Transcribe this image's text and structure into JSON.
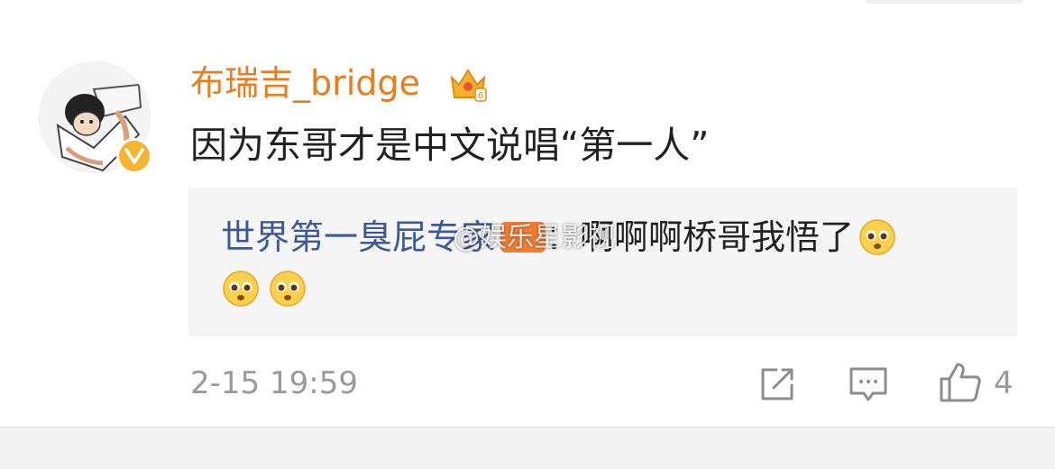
{
  "comment": {
    "username": "布瑞吉_bridge",
    "text": "因为东哥才是中文说唱“第一人”",
    "timestamp": "2-15 19:59",
    "like_count": "4"
  },
  "reply": {
    "username": "世界第一臭屁专家",
    "separator": "：",
    "text": "啊啊啊桥哥我悟了"
  },
  "watermark": "@娱乐星影视",
  "icons": {
    "avatar": "cartoon-avatar",
    "verified": "verified-v-icon",
    "crown": "crown-icon",
    "level_badge": "level-badge",
    "emoji": "pleading-face-emoji",
    "share": "share-icon",
    "comment": "comment-icon",
    "like": "thumbs-up-icon"
  },
  "colors": {
    "username": "#e67e22",
    "reply_username": "#3d5a95",
    "verified_badge": "#f6b530",
    "level_badge": "#f37d33",
    "reply_bg": "#f5f5f5"
  }
}
